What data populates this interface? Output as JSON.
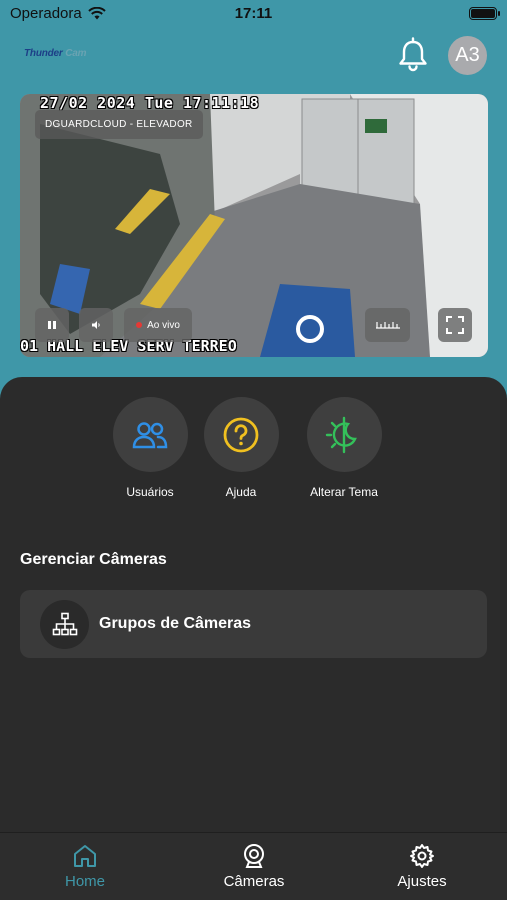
{
  "status_bar": {
    "carrier": "Operadora",
    "time": "17:11"
  },
  "header": {
    "logo_word1": "Thunder",
    "logo_word2": "Cam",
    "avatar_initials": "A3"
  },
  "camera": {
    "osd_datetime": "27/02 2024 Tue 17:11:18",
    "osd_location": "01 HALL ELEV SERV TERREO",
    "name": "DGUARDCLOUD - ELEVADOR",
    "live_label": "Ao vivo"
  },
  "actions": [
    {
      "label": "Usuários",
      "icon": "users-icon",
      "color": "#2f8fe6"
    },
    {
      "label": "Ajuda",
      "icon": "help-icon",
      "color": "#f0c020"
    },
    {
      "label": "Alterar Tema",
      "icon": "theme-icon",
      "color": "#34c05a"
    }
  ],
  "manage": {
    "title": "Gerenciar Câmeras",
    "groups_label": "Grupos de Câmeras"
  },
  "tabs": [
    {
      "label": "Home",
      "active": true
    },
    {
      "label": "Câmeras",
      "active": false
    },
    {
      "label": "Ajustes",
      "active": false
    }
  ],
  "colors": {
    "brand": "#3f97a8",
    "sheet": "#2b2b2b",
    "card": "#3a3a3a"
  }
}
